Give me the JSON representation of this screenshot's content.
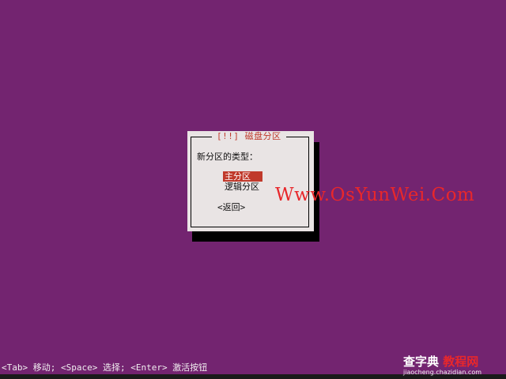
{
  "dialog": {
    "title": "[!!] 磁盘分区",
    "prompt": "新分区的类型：",
    "options": [
      "主分区",
      "逻辑分区"
    ],
    "selected_index": 0,
    "back_label": "<返回>"
  },
  "watermark": "Www.OsYunWei.Com",
  "statusbar": "<Tab> 移动; <Space> 选择; <Enter> 激活按钮",
  "logo": {
    "main_prefix": "查字典",
    "main_suffix": "教程网",
    "sub": "jiaocheng.chazidian.com"
  },
  "colors": {
    "background": "#732470",
    "dialog_bg": "#e9e4e4",
    "accent": "#c0392b",
    "watermark": "#e8272b"
  }
}
